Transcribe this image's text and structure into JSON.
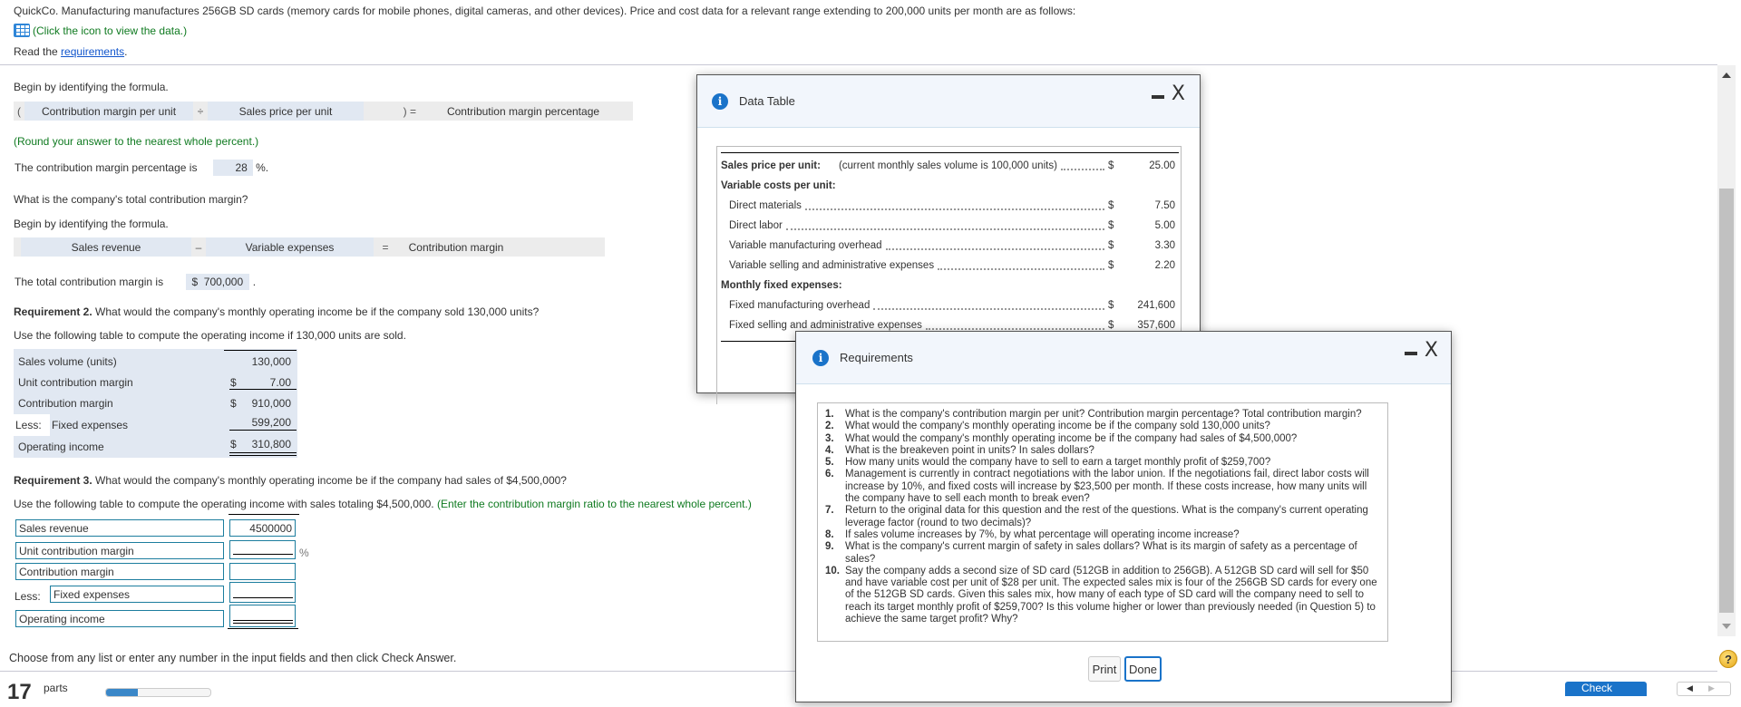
{
  "intro": {
    "problem_text": "QuickCo. Manufacturing manufactures 256GB SD cards (memory cards for mobile phones, digital cameras, and other devices). Price and cost data for a relevant range extending to 200,000 units per month are as follows:",
    "data_link_text": "(Click the icon to view the data.)",
    "read_prefix": "Read the ",
    "requirements_link": "requirements",
    "read_suffix": "."
  },
  "req1": {
    "begin_formula_1": "Begin by identifying the formula.",
    "formula1": {
      "open_paren": "(",
      "cell1": "Contribution margin per unit",
      "op1": "÷",
      "cell2": "Sales price per unit",
      "op2": ") =",
      "result": "Contribution margin percentage"
    },
    "round_note": "(Round your answer to the nearest whole percent.)",
    "cm_pct_label": "The contribution margin percentage is",
    "cm_pct_value": "28",
    "cm_pct_suffix": "%.",
    "total_cm_question": "What is the company's total contribution margin?",
    "begin_formula_2": "Begin by identifying the formula.",
    "formula2": {
      "cell1": "Sales revenue",
      "op1": "–",
      "cell2": "Variable expenses",
      "op2": "=",
      "result": "Contribution margin"
    },
    "total_cm_label": "The total contribution margin is",
    "total_cm_value": "$  700,000",
    "total_cm_suffix": "."
  },
  "req2": {
    "heading_bold": "Requirement 2.",
    "heading_text": " What would the company's monthly operating income be if the company sold 130,000 units?",
    "instruction": "Use the following table to compute the operating income if 130,000 units are sold.",
    "rows": [
      {
        "label": "Sales volume (units)",
        "dollar": "",
        "value": "130,000"
      },
      {
        "label": "Unit contribution margin",
        "dollar": "$",
        "value": "7.00"
      },
      {
        "label": "Contribution margin",
        "dollar": "$",
        "value": "910,000"
      },
      {
        "prefix": "Less:",
        "label": "Fixed expenses",
        "dollar": "",
        "value": "599,200"
      },
      {
        "label": "Operating income",
        "dollar": "$",
        "value": "310,800"
      }
    ]
  },
  "req3": {
    "heading_bold": "Requirement 3.",
    "heading_text": " What would the company's monthly operating income be if the company had sales of $4,500,000?",
    "instruction": "Use the following table to compute the operating income with sales totaling $4,500,000.",
    "instruction_note": " (Enter the contribution margin ratio to the nearest whole percent.)",
    "rows": [
      {
        "label": "Sales revenue",
        "value": "4500000",
        "suffix": ""
      },
      {
        "label": "Unit contribution margin",
        "value": "",
        "suffix": "%"
      },
      {
        "label": "Contribution margin",
        "value": "",
        "suffix": ""
      },
      {
        "prefix": "Less:",
        "label": "Fixed expenses",
        "value": "",
        "suffix": ""
      },
      {
        "label": "Operating income",
        "value": "",
        "suffix": ""
      }
    ]
  },
  "footer": {
    "instruction": "Choose from any list or enter any number in the input fields and then click Check Answer.",
    "parts_count": "17",
    "parts_label": "parts",
    "progress_fraction": 0.3,
    "check_answer_label": "Check Answer"
  },
  "data_table_dialog": {
    "title": "Data Table",
    "rows": [
      {
        "label": "Sales price per unit:",
        "note": "(current monthly sales volume is 100,000 units)",
        "dollar": "$",
        "value": "25.00",
        "bold": true,
        "indent": false
      },
      {
        "label": "Variable costs per unit:",
        "dollar": "",
        "value": "",
        "bold": true,
        "indent": false,
        "header": true
      },
      {
        "label": "Direct materials",
        "dollar": "$",
        "value": "7.50",
        "indent": true
      },
      {
        "label": "Direct labor",
        "dollar": "$",
        "value": "5.00",
        "indent": true
      },
      {
        "label": "Variable manufacturing overhead",
        "dollar": "$",
        "value": "3.30",
        "indent": true
      },
      {
        "label": "Variable selling and administrative expenses",
        "dollar": "$",
        "value": "2.20",
        "indent": true
      },
      {
        "label": "Monthly fixed expenses:",
        "dollar": "",
        "value": "",
        "bold": true,
        "indent": false,
        "header": true
      },
      {
        "label": "Fixed manufacturing overhead",
        "dollar": "$",
        "value": "241,600",
        "indent": true
      },
      {
        "label": "Fixed selling and administrative expenses",
        "dollar": "$",
        "value": "357,600",
        "indent": true
      }
    ]
  },
  "requirements_dialog": {
    "title": "Requirements",
    "items": [
      {
        "num": "1.",
        "text": "What is the company's contribution margin per unit? Contribution margin percentage? Total contribution margin?"
      },
      {
        "num": "2.",
        "text": "What would the company's monthly operating income be if the company sold 130,000 units?"
      },
      {
        "num": "3.",
        "text": "What would the company's monthly operating income be if the company had sales of $4,500,000?"
      },
      {
        "num": "4.",
        "text": "What is the breakeven point in units? In sales dollars?"
      },
      {
        "num": "5.",
        "text": "How many units would the company have to sell to earn a target monthly profit of $259,700?"
      },
      {
        "num": "6.",
        "text": "Management is currently in contract negotiations with the labor union. If the negotiations fail, direct labor costs will increase by 10%, and fixed costs will increase by $23,500 per month. If these costs increase, how many units will the company have to sell each month to break even?"
      },
      {
        "num": "7.",
        "text": "Return to the original data for this question and the rest of the questions. What is the company's current operating leverage factor (round to two decimals)?"
      },
      {
        "num": "8.",
        "text": "If sales volume increases by 7%, by what percentage will operating income increase?"
      },
      {
        "num": "9.",
        "text": "What is the company's current margin of safety in sales dollars? What is its margin of safety as a percentage of sales?"
      },
      {
        "num": "10.",
        "text": "Say the company adds a second size of SD card (512GB in addition to 256GB). A 512GB SD card will sell for $50 and have variable cost per unit of $28 per unit. The expected sales mix is four of the 256GB SD cards for every one of the 512GB SD cards. Given this sales mix, how many of each type of SD card will the company need to sell to reach its target monthly profit of $259,700? Is this volume higher or lower than previously needed (in Question 5) to achieve the same target profit? Why?"
      }
    ],
    "print_label": "Print",
    "done_label": "Done"
  },
  "icons": {
    "data_icon": "grid-table-icon",
    "info_icon": "i",
    "help_icon": "?"
  }
}
